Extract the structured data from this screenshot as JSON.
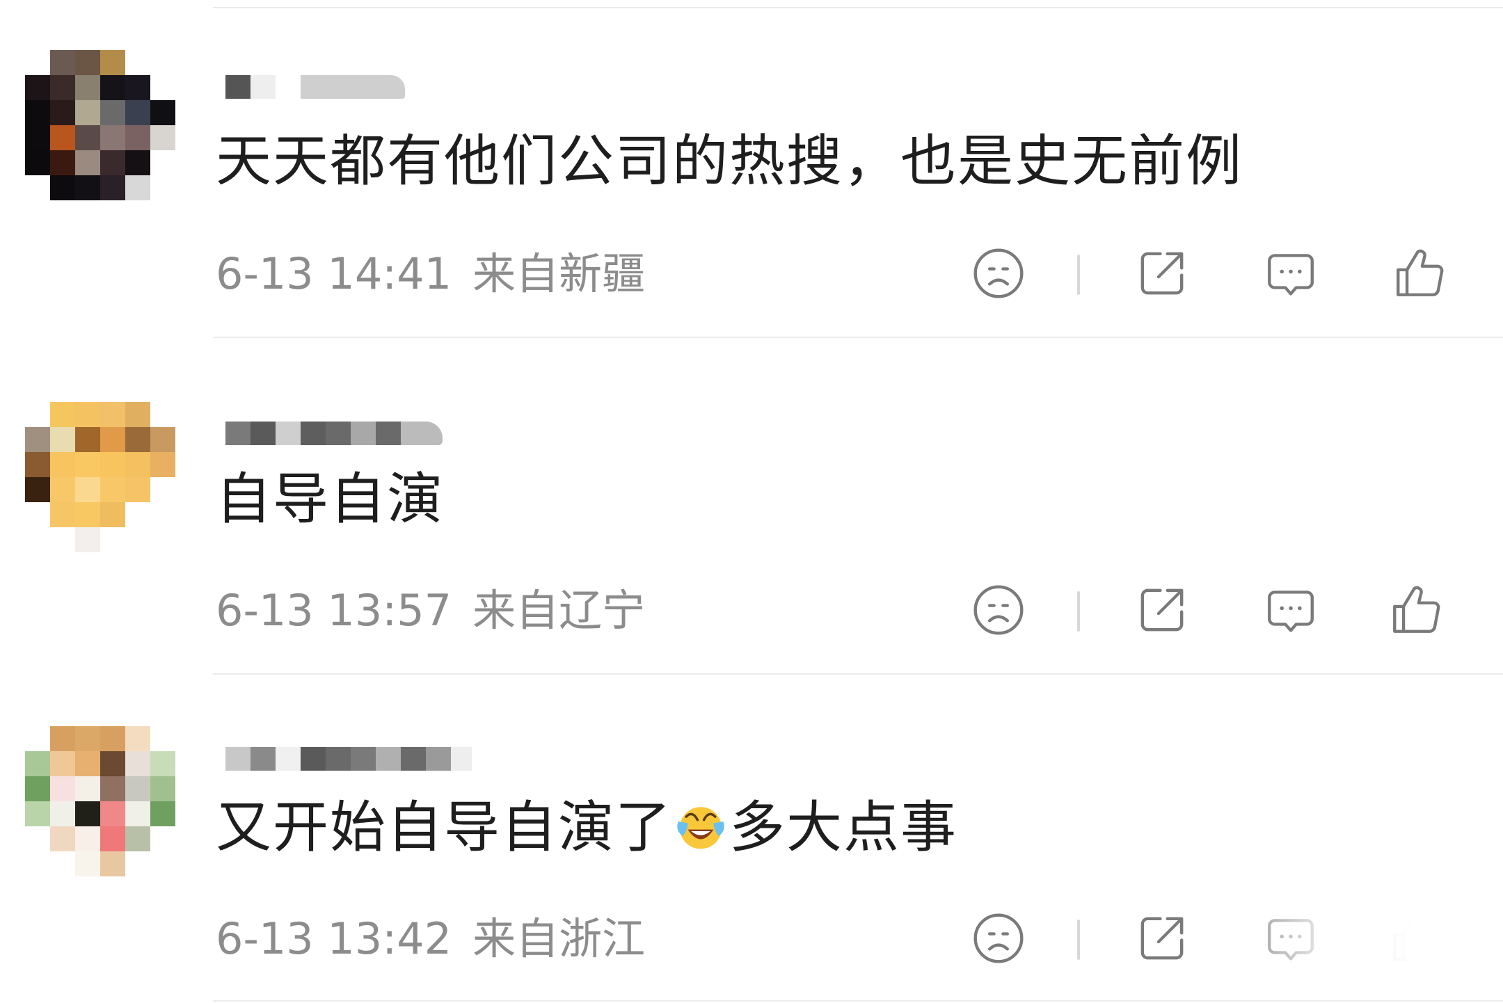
{
  "comments": [
    {
      "content": "天天都有他们公司的热搜，也是史无前例",
      "time": "6-13 14:41",
      "location": "来自新疆"
    },
    {
      "content": "自导自演",
      "time": "6-13 13:57",
      "location": "来自辽宁"
    },
    {
      "content_before": "又开始自导自演了",
      "content_after": "多大点事",
      "emoji": "laughing-crying-emoji",
      "time": "6-13 13:42",
      "location": "来自浙江"
    }
  ],
  "icons": {
    "dislike": "sad-face-icon",
    "share": "share-icon",
    "reply": "comment-bubble-icon",
    "like": "thumbs-up-icon"
  },
  "colors": {
    "meta_text": "#8c8c8c",
    "icon_stroke": "#7a7a7a",
    "divider": "#ececec"
  }
}
